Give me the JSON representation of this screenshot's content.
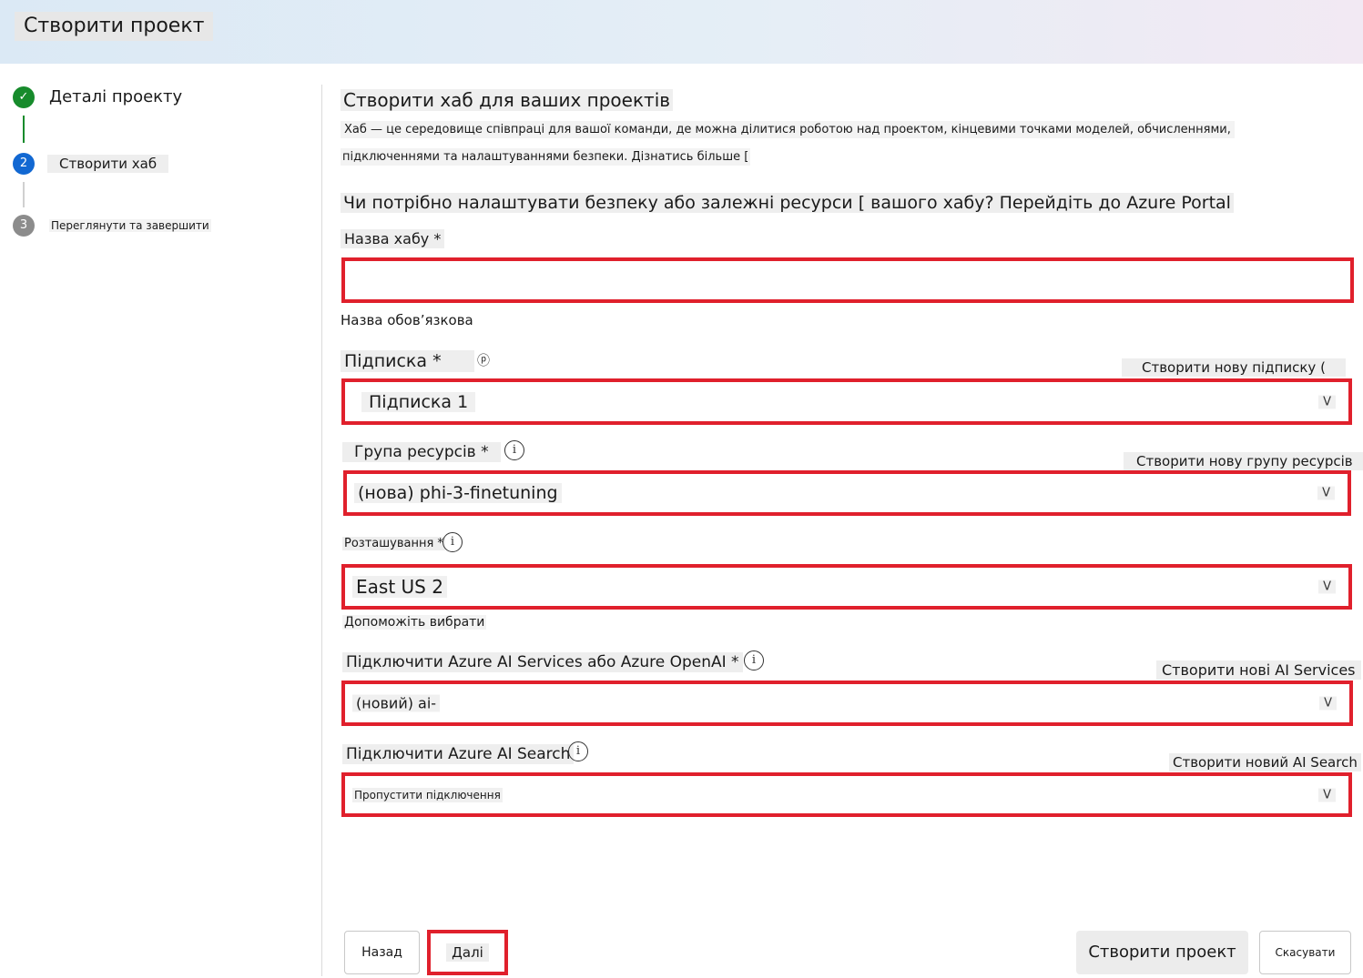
{
  "header": {
    "title": "Створити проект"
  },
  "stepper": {
    "steps": [
      {
        "number": "✓",
        "label": "Деталі проекту",
        "state": "completed"
      },
      {
        "number": "2",
        "label": "Створити хаб",
        "state": "current"
      },
      {
        "number": "3",
        "label": "Переглянути та завершити",
        "state": "pending"
      }
    ]
  },
  "section": {
    "title": "Створити хаб для ваших проектів",
    "description_line1": "Хаб — це середовище співпраці для вашої команди, де можна ділитися роботою над проектом, кінцевими точками моделей, обчисленнями,",
    "description_line2": "підключеннями та налаштуваннями безпеки. Дізнатись більше [",
    "security_question": "Чи потрібно налаштувати безпеку або залежні ресурси [ вашого хабу? Перейдіть до Azure Portal"
  },
  "form": {
    "hub_name": {
      "label": "Назва хабу *",
      "value": "",
      "error": "Назва обов’язкова"
    },
    "subscription": {
      "label": "Підписка *",
      "icon_glyph": "ⓟ",
      "value": "Підписка 1",
      "create_link": "Створити нову підписку ("
    },
    "resource_group": {
      "label": "Група ресурсів *",
      "value": "(нова) phi-3-finetuning",
      "create_link": "Створити нову групу ресурсів"
    },
    "location": {
      "label": "Розташування *",
      "value": "East US 2",
      "help": "Допоможіть вибрати"
    },
    "ai_services": {
      "label": "Підключити Azure AI Services або Azure OpenAI *",
      "value": "(новий) ai-",
      "create_link": "Створити нові AI Services"
    },
    "ai_search": {
      "label": "Підключити Azure AI Search",
      "value": "Пропустити підключення",
      "create_link": "Створити новий AI Search"
    },
    "chevron_glyph": "V",
    "info_glyph": "i"
  },
  "footer": {
    "back_label": "Назад",
    "next_label": "Далі",
    "create_label": "Створити проект",
    "cancel_label": "Скасувати"
  },
  "colors": {
    "highlight_border": "#e0202c",
    "step_completed": "#178b2c",
    "step_current": "#1268d2",
    "step_pending": "#8c8c8c"
  }
}
